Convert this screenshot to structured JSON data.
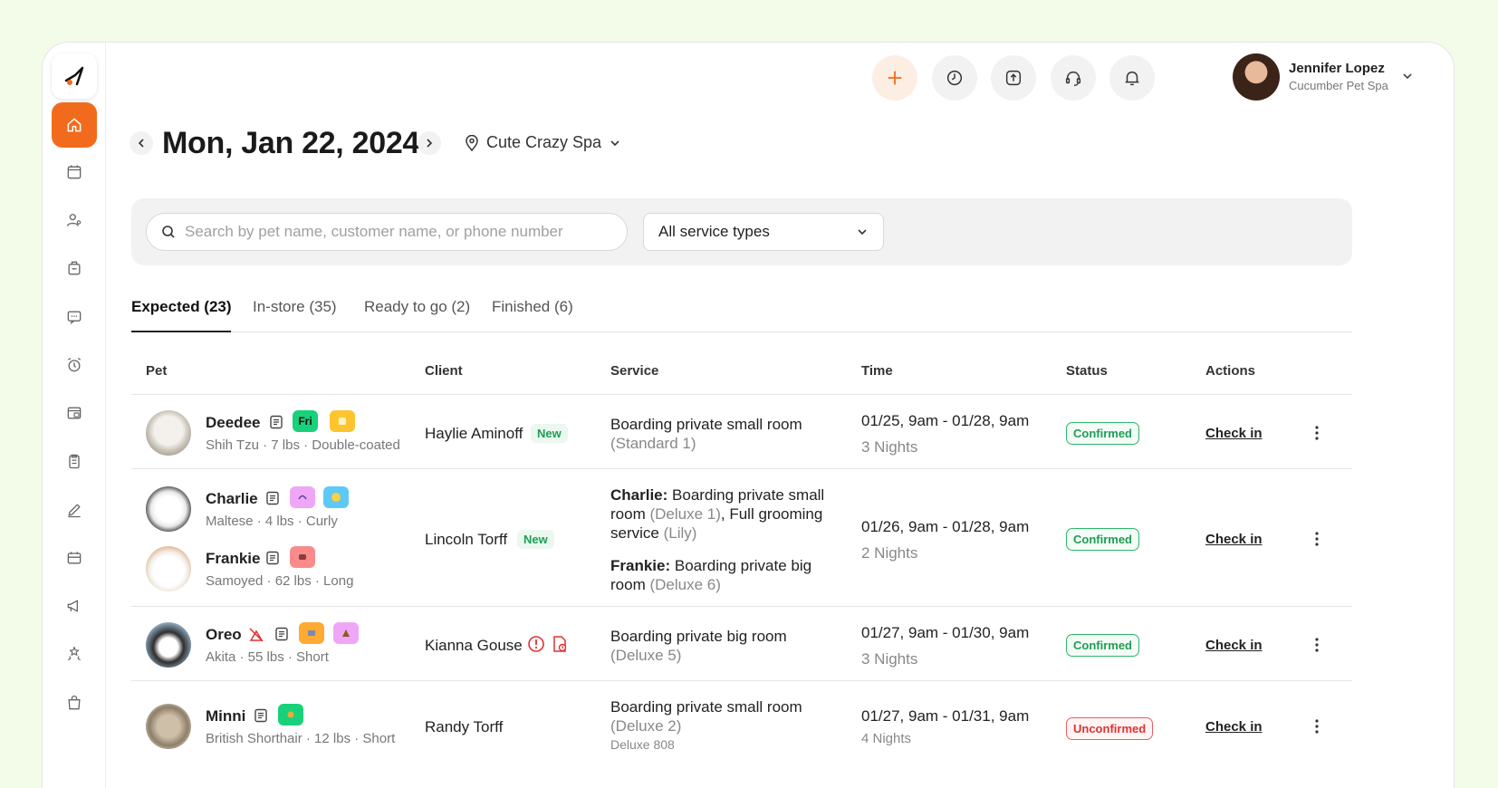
{
  "header": {
    "date": "Mon, Jan 22, 2024",
    "location": "Cute Crazy Spa",
    "user": {
      "name": "Jennifer Lopez",
      "org": "Cucumber Pet Spa"
    }
  },
  "filters": {
    "search_placeholder": "Search by pet name, customer name, or phone number",
    "service_type": "All service types"
  },
  "tabs": [
    {
      "label": "Expected (23)"
    },
    {
      "label": "In-store (35)"
    },
    {
      "label": "Ready to go (2)"
    },
    {
      "label": "Finished (6)"
    }
  ],
  "columns": [
    "Pet",
    "Client",
    "Service",
    "Time",
    "Status",
    "Actions"
  ],
  "rows": [
    {
      "pets": [
        {
          "name": "Deedee",
          "meta": "Shih Tzu · 7 lbs · Double-coated",
          "tag1": "Fri"
        }
      ],
      "client": "Haylie Aminoff",
      "new": "New",
      "service_line1": "Boarding private small room",
      "service_line2": "(Standard 1)",
      "time": "01/25, 9am - 01/28, 9am",
      "nights": "3 Nights",
      "status": "Confirmed",
      "action": "Check in"
    },
    {
      "pets": [
        {
          "name": "Charlie",
          "meta": "Maltese · 4 lbs · Curly"
        },
        {
          "name": "Frankie",
          "meta": "Samoyed · 62 lbs · Long"
        }
      ],
      "client": "Lincoln Torff",
      "new": "New",
      "service_a_name": "Charlie:",
      "service_a_text": " Boarding private small room ",
      "service_a_muted1": "(Deluxe 1)",
      "service_a_text2": ", Full grooming service ",
      "service_a_muted2": "(Lily)",
      "service_b_name": "Frankie:",
      "service_b_text": " Boarding private big room ",
      "service_b_muted": "(Deluxe 6)",
      "time": "01/26, 9am - 01/28, 9am",
      "nights": "2 Nights",
      "status": "Confirmed",
      "action": "Check in"
    },
    {
      "pets": [
        {
          "name": "Oreo",
          "meta": "Akita · 55 lbs · Short"
        }
      ],
      "client": "Kianna Gouse",
      "service_line1": "Boarding private big room",
      "service_line2": "(Deluxe 5)",
      "time": "01/27, 9am - 01/30, 9am",
      "nights": "3 Nights",
      "status": "Confirmed",
      "action": "Check in"
    },
    {
      "pets": [
        {
          "name": "Minni",
          "meta": "British Shorthair · 12 lbs · Short"
        }
      ],
      "client": "Randy Torff",
      "service_line1": "Boarding private small room",
      "service_line2": "(Deluxe 2)",
      "service_line3": "Deluxe 808",
      "time": "01/27, 9am - 01/31, 9am",
      "nights": "4 Nights",
      "status": "Unconfirmed",
      "action": "Check in"
    }
  ],
  "colors": {
    "accent": "#f26b1d",
    "confirmed": "#1f9d55",
    "unconfirmed": "#e03131"
  }
}
